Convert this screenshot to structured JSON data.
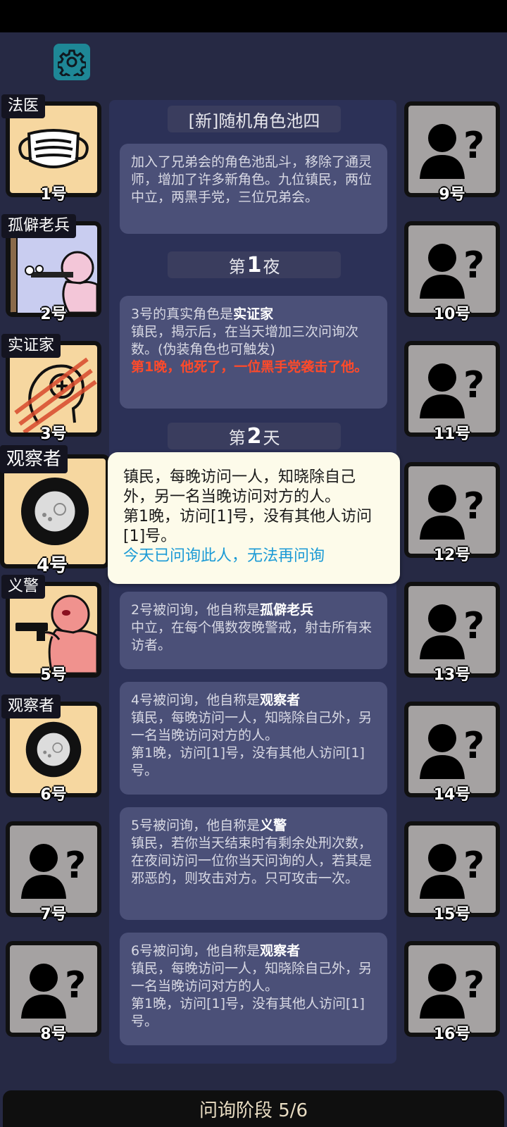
{
  "pool_title": "[新]随机角色池四",
  "pool_desc": "加入了兄弟会的角色池乱斗，移除了通灵师，增加了许多新角色。九位镇民，两位中立，两黑手党，三位兄弟会。",
  "night1": {
    "prefix": "第",
    "num": "1",
    "suffix": "夜"
  },
  "day2": {
    "prefix": "第",
    "num": "2",
    "suffix": "天"
  },
  "reveal": {
    "lead": "3号的真实角色是",
    "role": "实证家",
    "desc": "镇民，揭示后，在当天增加三次问询次数。(伪装角色也可触发)",
    "death": "第1晚，他死了，一位黑手党袭击了他。"
  },
  "popup": {
    "desc": "镇民，每晚访问一人，知晓除自己外，另一名当晚访问对方的人。",
    "result": "第1晚，访问[1]号，没有其他人访问[1]号。",
    "notice": "今天已问询此人，无法再问询"
  },
  "interrogations": [
    {
      "lead": "2号被问询，他自称是",
      "role": "孤僻老兵",
      "desc": "中立，在每个偶数夜晚警戒，射击所有来访者。",
      "result": ""
    },
    {
      "lead": "4号被问询，他自称是",
      "role": "观察者",
      "desc": "镇民，每晚访问一人，知晓除自己外，另一名当晚访问对方的人。",
      "result": "第1晚，访问[1]号，没有其他人访问[1]号。"
    },
    {
      "lead": "5号被问询，他自称是",
      "role": "义警",
      "desc": "镇民，若你当天结束时有剩余处刑次数，在夜间访问一位你当天问询的人，若其是邪恶的，则攻击对方。只可攻击一次。",
      "result": ""
    },
    {
      "lead": "6号被问询，他自称是",
      "role": "观察者",
      "desc": "镇民，每晚访问一人，知晓除自己外，另一名当晚访问对方的人。",
      "result": "第1晚，访问[1]号，没有其他人访问[1]号。"
    }
  ],
  "players_left": [
    {
      "num": "1号",
      "role": "法医",
      "icon": "mask-icon"
    },
    {
      "num": "2号",
      "role": "孤僻老兵",
      "icon": "veteran-icon"
    },
    {
      "num": "3号",
      "role": "实证家",
      "icon": "mind-scratch-icon"
    },
    {
      "num": "4号",
      "role": "观察者",
      "icon": "lens-icon"
    },
    {
      "num": "5号",
      "role": "义警",
      "icon": "gunman-icon"
    },
    {
      "num": "6号",
      "role": "观察者",
      "icon": "lens-icon"
    },
    {
      "num": "7号",
      "role": "",
      "icon": "unknown-person-icon"
    },
    {
      "num": "8号",
      "role": "",
      "icon": "unknown-person-icon"
    }
  ],
  "players_right": [
    {
      "num": "9号"
    },
    {
      "num": "10号"
    },
    {
      "num": "11号"
    },
    {
      "num": "12号"
    },
    {
      "num": "13号"
    },
    {
      "num": "14号"
    },
    {
      "num": "15号"
    },
    {
      "num": "16号"
    }
  ],
  "phase": "问询阶段 5/6",
  "colors": {
    "background": "#262944",
    "panel": "#2c3157",
    "card": "#4b5078",
    "accent": "#1e8796",
    "alert": "#ff4a2a",
    "link": "#1a9ad6"
  }
}
